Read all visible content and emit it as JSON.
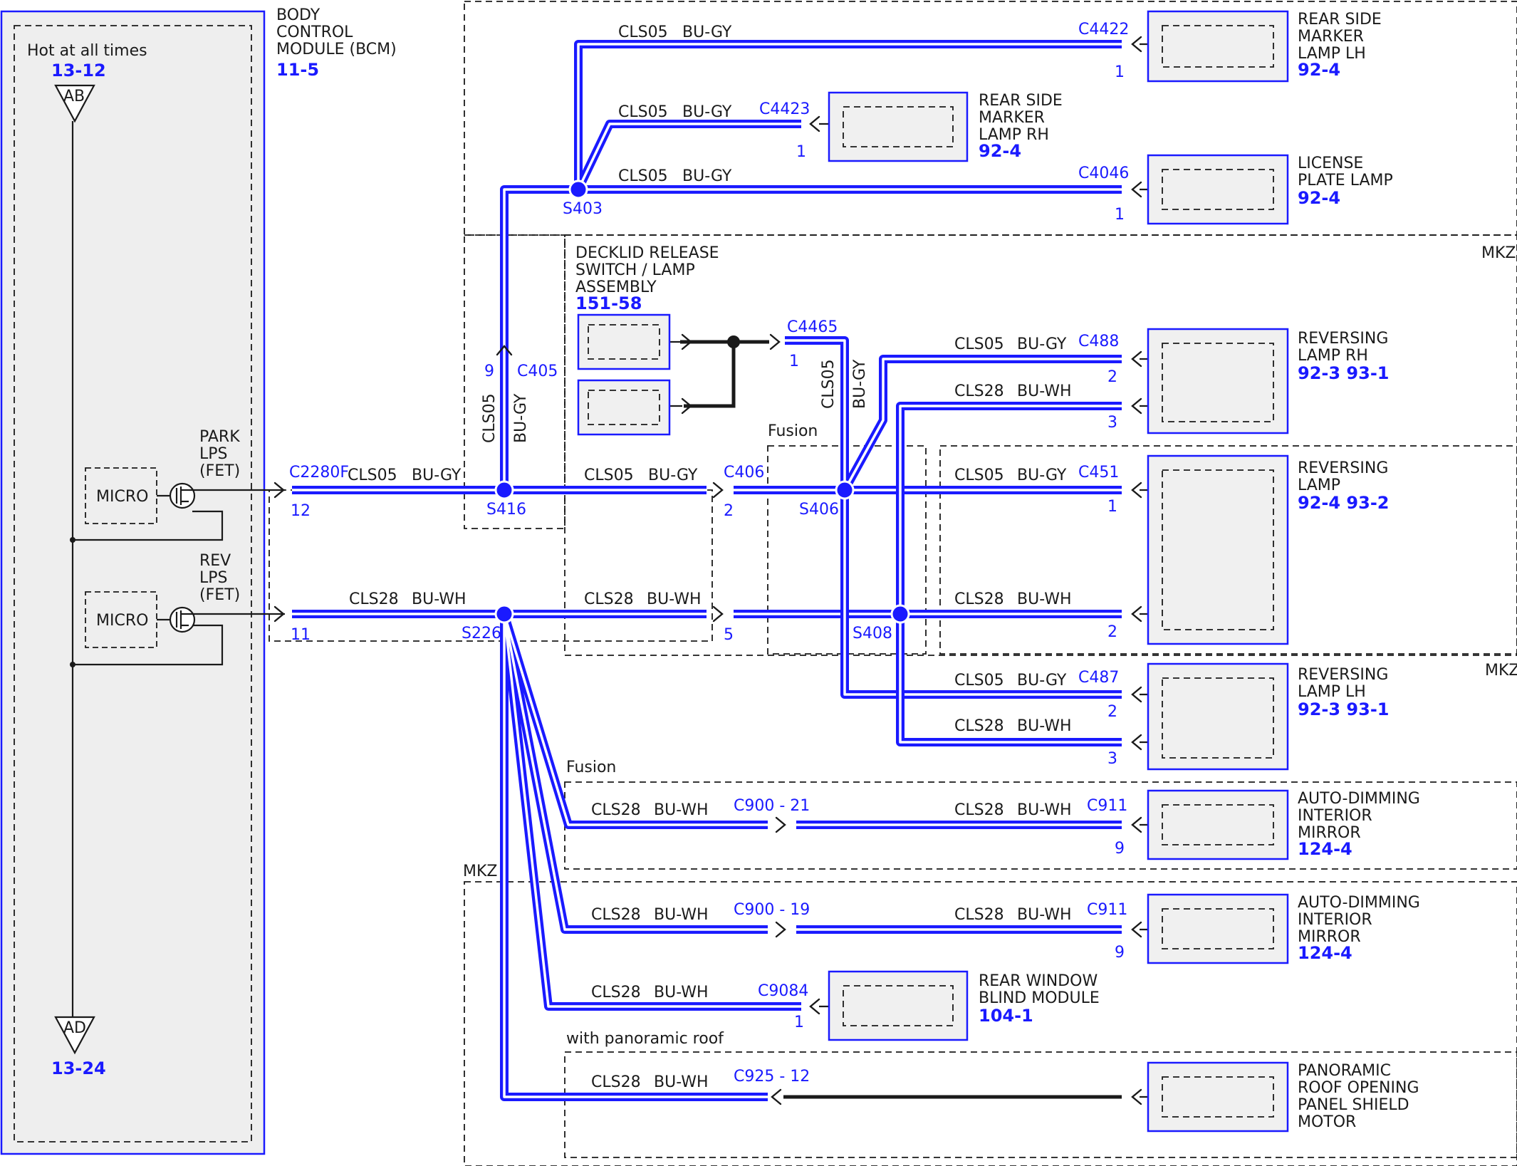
{
  "bcm": {
    "hot_label": "Hot at all times",
    "hot_ref": "13-12",
    "top_term": "AB",
    "bottom_term": "AD",
    "bottom_ref": "13-24",
    "title_lines": [
      "BODY",
      "CONTROL",
      "MODULE (BCM)"
    ],
    "ref": "11-5",
    "micro1": "MICRO",
    "micro2": "MICRO",
    "park_lines": [
      "PARK",
      "LPS",
      "(FET)"
    ],
    "rev_lines": [
      "REV",
      "LPS",
      "(FET)"
    ]
  },
  "zones": {
    "mkz_top": "MKZ",
    "mkz_mid": "MKZ",
    "mkz_low": "MKZ",
    "fusion_mid": "Fusion",
    "fusion_low": "Fusion",
    "panoramic": "with panoramic roof"
  },
  "connectors": {
    "c2280f": "C2280F",
    "c2280f_pin_park": "12",
    "c2280f_pin_rev": "11",
    "c405": "C405",
    "c405_pin": "9",
    "c406": "C406",
    "c406_pin_a": "2",
    "c406_pin_b": "5",
    "c4422": "C4422",
    "c4422_pin": "1",
    "c4423": "C4423",
    "c4423_pin": "1",
    "c4046": "C4046",
    "c4046_pin": "1",
    "c4465": "C4465",
    "c4465_pin": "1",
    "c488": "C488",
    "c488_pin_a": "2",
    "c488_pin_b": "3",
    "c451": "C451",
    "c451_pin_a": "1",
    "c451_pin_b": "2",
    "c487": "C487",
    "c487_pin_a": "2",
    "c487_pin_b": "3",
    "c900_21": "C900 - 21",
    "c911_a": "C911",
    "c911_a_pin": "9",
    "c900_19": "C900 - 19",
    "c911_b": "C911",
    "c911_b_pin": "9",
    "c9084": "C9084",
    "c9084_pin": "1",
    "c925_12": "C925 - 12"
  },
  "splices": {
    "s403": "S403",
    "s416": "S416",
    "s226": "S226",
    "s406": "S406",
    "s408": "S408"
  },
  "wires": {
    "cls05": "CLS05",
    "bugy": "BU-GY",
    "cls28": "CLS28",
    "buwh": "BU-WH"
  },
  "components": {
    "rear_side_lh": {
      "lines": [
        "REAR SIDE",
        "MARKER",
        "LAMP LH"
      ],
      "ref": "92-4"
    },
    "rear_side_rh": {
      "lines": [
        "REAR SIDE",
        "MARKER",
        "LAMP RH"
      ],
      "ref": "92-4"
    },
    "license": {
      "lines": [
        "LICENSE",
        "PLATE LAMP"
      ],
      "ref": "92-4"
    },
    "decklid": {
      "lines": [
        "DECKLID RELEASE",
        "SWITCH / LAMP",
        "ASSEMBLY"
      ],
      "ref": "151-58"
    },
    "rev_rh": {
      "lines": [
        "REVERSING",
        "LAMP RH"
      ],
      "ref": "92-3   93-1"
    },
    "rev_lamp": {
      "lines": [
        "REVERSING",
        "LAMP"
      ],
      "ref": "92-4   93-2"
    },
    "rev_lh": {
      "lines": [
        "REVERSING",
        "LAMP LH"
      ],
      "ref": "92-3   93-1"
    },
    "mirror_a": {
      "lines": [
        "AUTO-DIMMING",
        "INTERIOR",
        "MIRROR"
      ],
      "ref": "124-4"
    },
    "mirror_b": {
      "lines": [
        "AUTO-DIMMING",
        "INTERIOR",
        "MIRROR"
      ],
      "ref": "124-4"
    },
    "blind": {
      "lines": [
        "REAR WINDOW",
        "BLIND MODULE"
      ],
      "ref": "104-1"
    },
    "panoramic": {
      "lines": [
        "PANORAMIC",
        "ROOF OPENING",
        "PANEL SHIELD",
        "MOTOR"
      ],
      "ref": ""
    }
  }
}
